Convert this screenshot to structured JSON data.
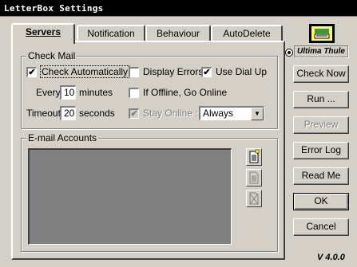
{
  "window": {
    "title": "LetterBox Settings"
  },
  "tabs": [
    {
      "label": "Servers",
      "active": true
    },
    {
      "label": "Notification",
      "active": false
    },
    {
      "label": "Behaviour",
      "active": false
    },
    {
      "label": "AutoDelete",
      "active": false
    }
  ],
  "check_mail": {
    "group_label": "Check Mail",
    "check_automatically": {
      "label": "Check Automatically",
      "checked": true
    },
    "display_errors": {
      "label": "Display Errors",
      "checked": false
    },
    "use_dial_up": {
      "label": "Use Dial Up",
      "checked": true
    },
    "every_label": "Every",
    "every_value": "10",
    "minutes_label": "minutes",
    "if_offline": {
      "label": "If Offline, Go Online",
      "checked": false
    },
    "timeout_label": "Timeout",
    "timeout_value": "20",
    "seconds_label": "seconds",
    "stay_online": {
      "label": "Stay Online :",
      "checked": true,
      "disabled": true
    },
    "stay_online_select": "Always"
  },
  "email_accounts": {
    "group_label": "E-mail Accounts",
    "icons": [
      "new-account-icon",
      "edit-account-icon",
      "delete-account-icon"
    ]
  },
  "brand": {
    "name": "Ultima Thule"
  },
  "buttons": {
    "check_now": "Check Now",
    "run": "Run ...",
    "preview": "Preview",
    "error_log": "Error Log",
    "read_me": "Read Me",
    "ok": "OK",
    "cancel": "Cancel"
  },
  "version": "V 4.0.0"
}
